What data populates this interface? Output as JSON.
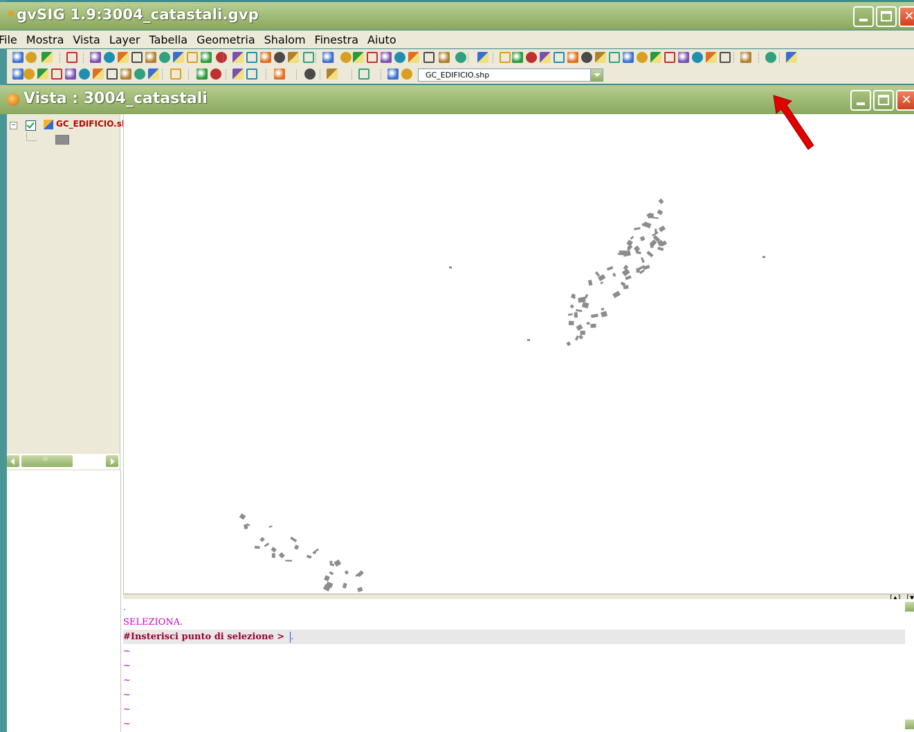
{
  "app": {
    "title": "gvSIG 1.9:3004_catastali.gvp"
  },
  "menu": [
    "File",
    "Mostra",
    "Vista",
    "Layer",
    "Tabella",
    "Geometria",
    "Shalom",
    "Finestra",
    "Aiuto"
  ],
  "toolbar": {
    "layer_combo_value": "GC_EDIFICIO.shp"
  },
  "view": {
    "title": "Vista : 3004_catastali"
  },
  "toc": {
    "layer_label": "GC_EDIFICIO.sh",
    "collapse_glyph": "−",
    "scroll_grip": "III"
  },
  "console": {
    "lines": [
      ".",
      "SELEZIONA."
    ],
    "prompt": "#Insterisci punto di selezione >",
    "prompt_tail": ".",
    "tilde": "~"
  },
  "split_controls": "[▲] [▼",
  "colors": {
    "titlebar": "#9cb872",
    "feature_fill": "#8c8c8c",
    "layer_label": "#c00000",
    "console_prompt": "#990033",
    "console_command": "#cc00cc",
    "annotation_arrow": "#e00000"
  },
  "icons": {
    "close": "close-icon",
    "maximize": "maximize-icon",
    "minimize": "minimize-icon",
    "annotation": "red-arrow-icon"
  }
}
